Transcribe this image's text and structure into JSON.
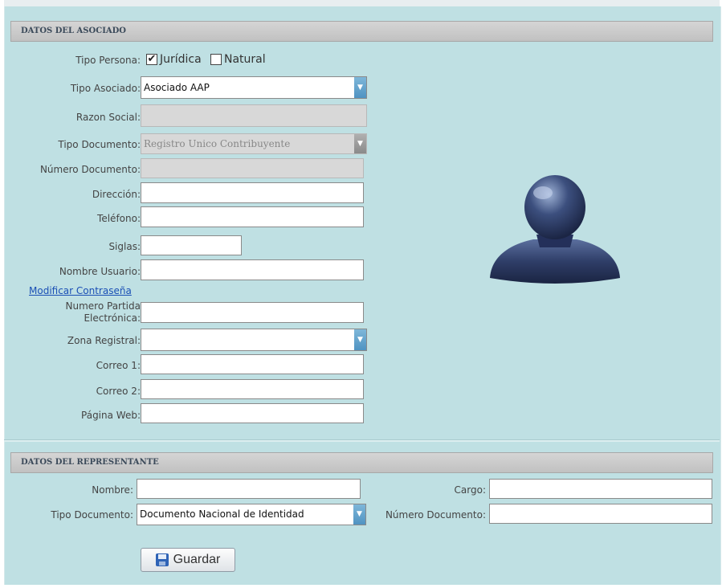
{
  "asociado": {
    "section_title": "DATOS DEL ASOCIADO",
    "tipo_persona": {
      "label": "Tipo Persona:",
      "juridica_label": "Jurídica",
      "juridica_checked": true,
      "natural_label": "Natural",
      "natural_checked": false,
      "check_mark": "✔"
    },
    "tipo_asociado": {
      "label": "Tipo Asociado:",
      "value": "Asociado AAP"
    },
    "razon_social": {
      "label": "Razon Social:",
      "value": ""
    },
    "tipo_documento": {
      "label": "Tipo Documento:",
      "value": "Registro Unico Contribuyente"
    },
    "numero_documento": {
      "label": "Número Documento:",
      "value": ""
    },
    "direccion": {
      "label": "Dirección:",
      "value": ""
    },
    "telefono": {
      "label": "Teléfono:",
      "value": ""
    },
    "siglas": {
      "label": "Siglas:",
      "value": ""
    },
    "nombre_usuario": {
      "label": "Nombre Usuario:",
      "value": ""
    },
    "modificar_contrasena": "Modificar Contraseña",
    "partida": {
      "label_line1": "Numero Partida",
      "label_line2": "Electrónica:",
      "value": ""
    },
    "zona_registral": {
      "label": "Zona Registral:",
      "value": ""
    },
    "correo1": {
      "label": "Correo 1:",
      "value": ""
    },
    "correo2": {
      "label": "Correo 2:",
      "value": ""
    },
    "pagina_web": {
      "label": "Página Web:",
      "value": ""
    },
    "avatar_icon": "user-silhouette-icon"
  },
  "representante": {
    "section_title": "DATOS DEL REPRESENTANTE",
    "nombre": {
      "label": "Nombre:",
      "value": ""
    },
    "cargo": {
      "label": "Cargo:",
      "value": ""
    },
    "tipo_documento": {
      "label": "Tipo Documento:",
      "value": "Documento Nacional de Identidad"
    },
    "numero_documento": {
      "label": "Número Documento:",
      "value": ""
    }
  },
  "actions": {
    "save_label": "Guardar",
    "save_icon": "floppy-disk-icon"
  },
  "colors": {
    "panel_bg": "#bfe0e3",
    "header_bg": "#c8c8c8",
    "select_arrow": "#5b9ecb",
    "link": "#1a4fb5"
  }
}
